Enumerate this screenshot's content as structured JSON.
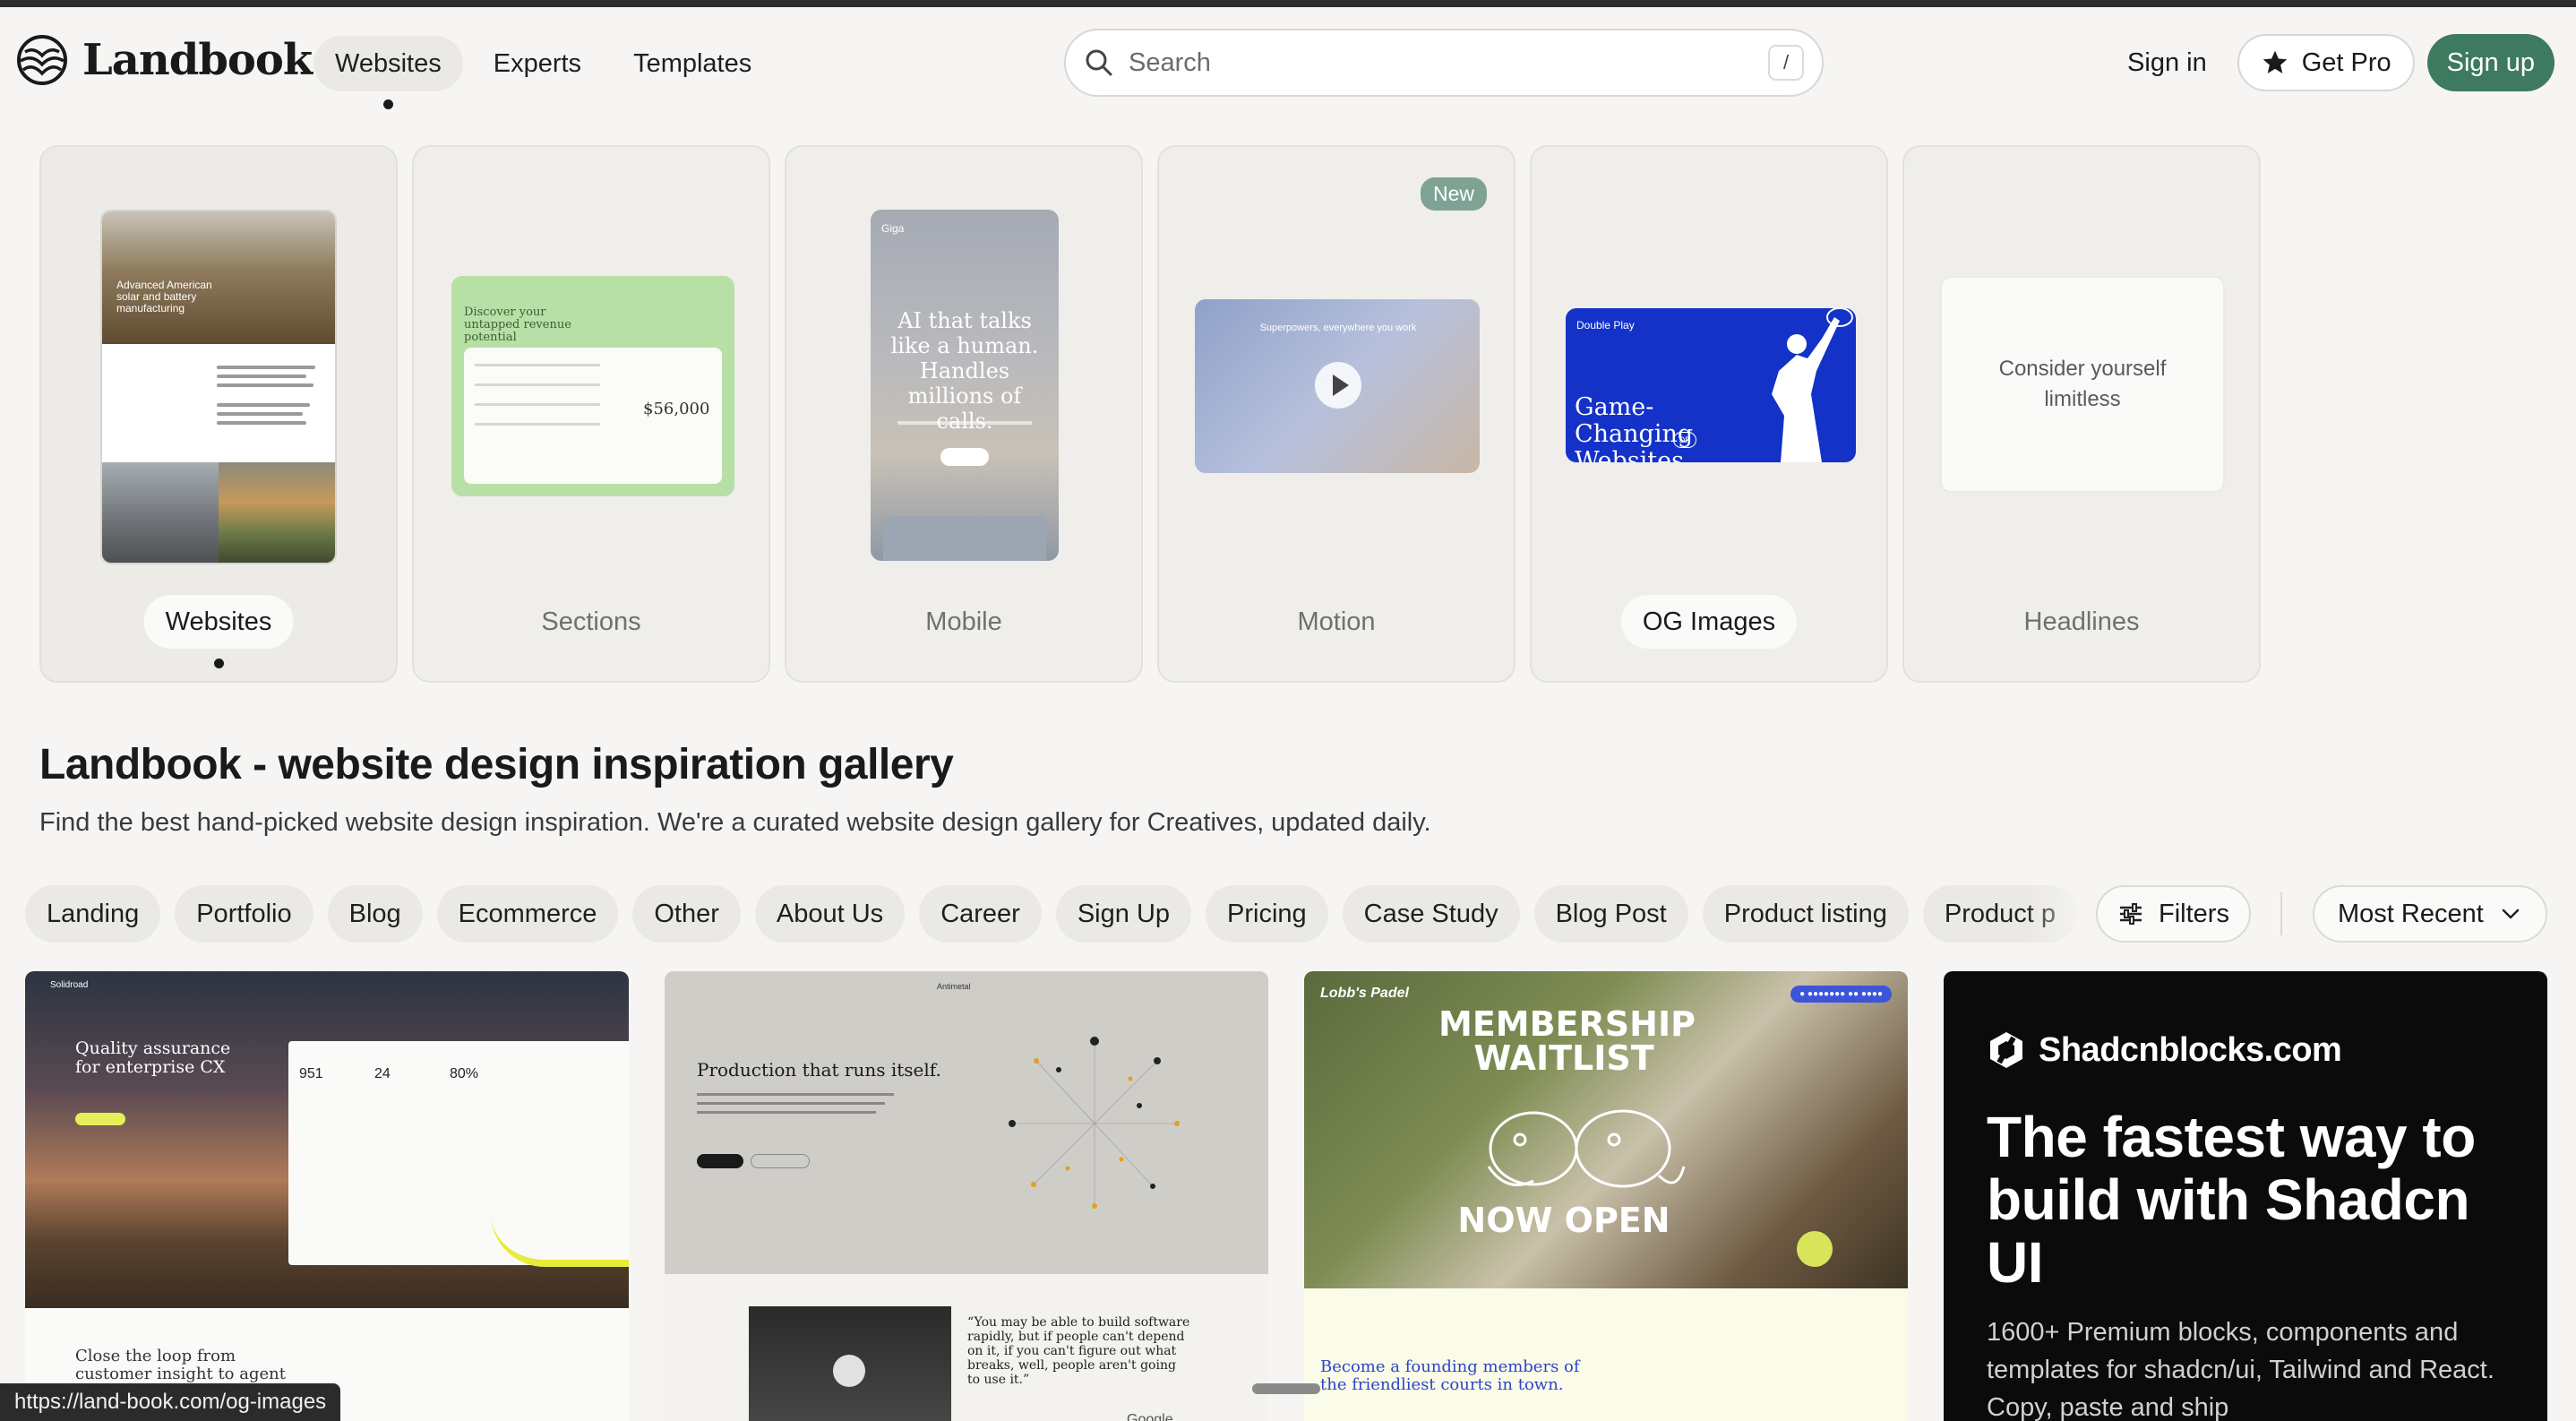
{
  "header": {
    "logo_text": "Landbook",
    "nav": [
      {
        "label": "Websites",
        "active": true
      },
      {
        "label": "Experts",
        "active": false
      },
      {
        "label": "Templates",
        "active": false
      }
    ],
    "search": {
      "placeholder": "Search",
      "shortcut": "/"
    },
    "sign_in": "Sign in",
    "get_pro": "Get Pro",
    "sign_up": "Sign up",
    "accent_color": "#3d7a60"
  },
  "categories": [
    {
      "label": "Websites",
      "active": true
    },
    {
      "label": "Sections",
      "active": false
    },
    {
      "label": "Mobile",
      "active": false
    },
    {
      "label": "Motion",
      "active": false,
      "badge": "New"
    },
    {
      "label": "OG Images",
      "active": false
    },
    {
      "label": "Headlines",
      "active": false
    }
  ],
  "previews": {
    "websites": {
      "hero": "Advanced American solar and battery manufacturing"
    },
    "sections": {
      "title": "Discover your untapped revenue potential",
      "value": "$56,000"
    },
    "mobile": {
      "brand": "Giga",
      "headline": "AI that talks like a human. Handles millions of calls."
    },
    "motion": {
      "headline": "Superpowers, everywhere you work"
    },
    "og": {
      "brand": "Double Play",
      "headline": "Game-Changing Websites",
      "badge": "DP"
    },
    "headlines": {
      "text": "Consider yourself limitless"
    }
  },
  "intro": {
    "title": "Landbook - website design inspiration gallery",
    "subtitle": "Find the best hand-picked website design inspiration. We're a curated website design gallery for Creatives, updated daily."
  },
  "filters": {
    "chips": [
      "Landing",
      "Portfolio",
      "Blog",
      "Ecommerce",
      "Other",
      "About Us",
      "Career",
      "Sign Up",
      "Pricing",
      "Case Study",
      "Blog Post",
      "Product listing",
      "Product p"
    ],
    "filters_label": "Filters",
    "sort_label": "Most Recent"
  },
  "gallery": [
    {
      "name": "Solidroad",
      "headline": "Quality assurance for enterprise CX",
      "stats": [
        "951",
        "24",
        "80%"
      ],
      "lower": "Close the loop from customer insight to agent improvement"
    },
    {
      "name": "Antimetal",
      "headline": "Production that runs itself.",
      "quote": "“You may be able to build software rapidly, but if people can't depend on it, if you can't figure out what breaks, well, people aren't going to use it.”",
      "footer": "Google"
    },
    {
      "name": "Lobb's Padel",
      "headline": "MEMBERSHIP WAITLIST",
      "headline2": "NOW OPEN",
      "lower": "Become a founding members of the friendliest courts in town."
    },
    {
      "name": "Shadcnblocks.com",
      "headline": "The fastest way to build with Shadcn UI",
      "desc": "1600+ Premium blocks, components and templates for shadcn/ui, Tailwind and React. Copy, paste and ship"
    }
  ],
  "status_bar": {
    "url": "https://land-book.com/og-images"
  }
}
